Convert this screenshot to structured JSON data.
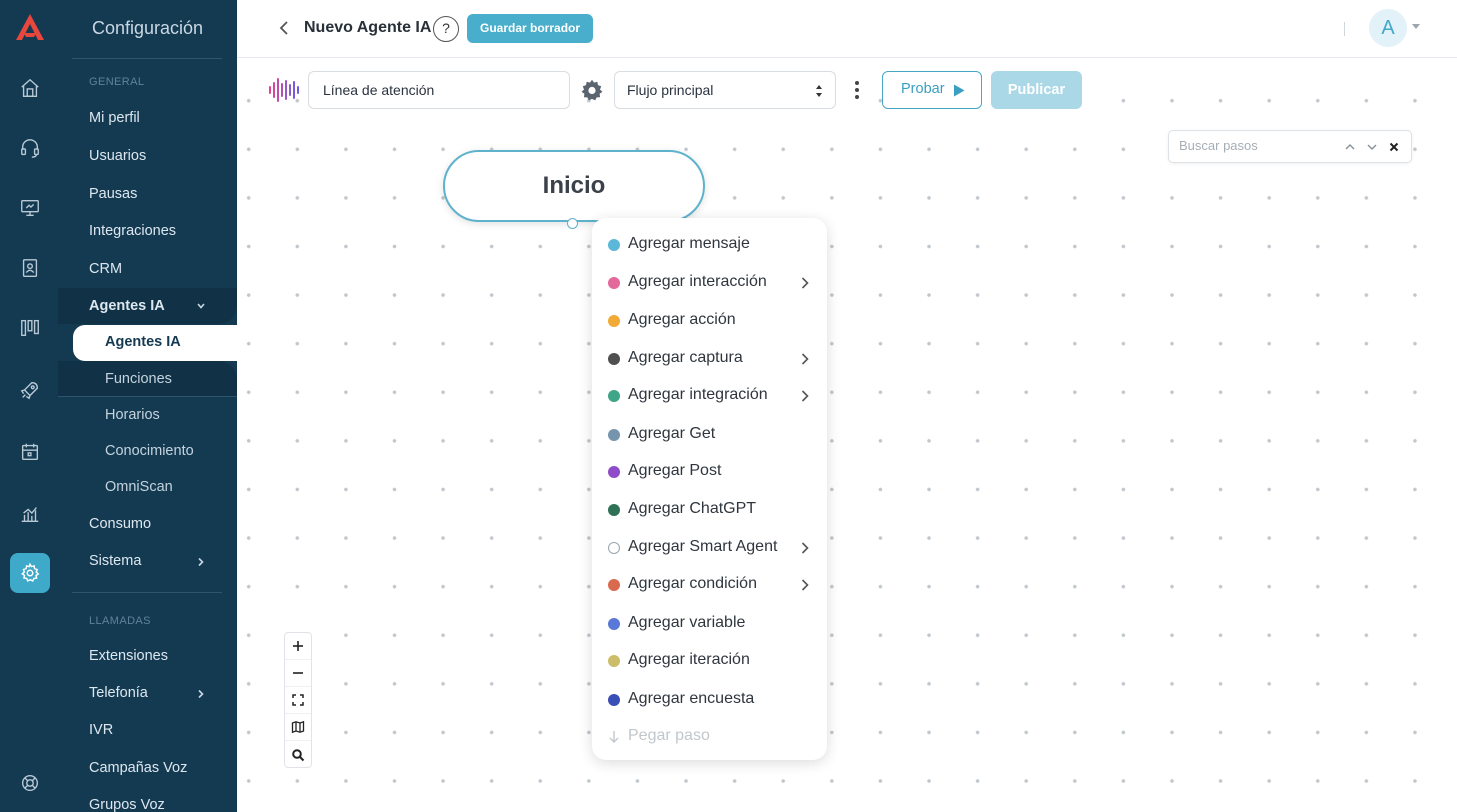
{
  "sidebar": {
    "title": "Configuración",
    "section_general": "GENERAL",
    "section_calls": "LLAMADAS",
    "items": {
      "profile": "Mi perfil",
      "users": "Usuarios",
      "pauses": "Pausas",
      "integrations": "Integraciones",
      "crm": "CRM",
      "ai_agents": "Agentes IA",
      "consumption": "Consumo",
      "system": "Sistema",
      "extensions": "Extensiones",
      "telephony": "Telefonía",
      "ivr": "IVR",
      "voice_campaigns": "Campañas Voz",
      "voice_groups": "Grupos Voz"
    },
    "ai_sub": {
      "agents": "Agentes IA",
      "functions": "Funciones",
      "schedules": "Horarios",
      "knowledge": "Conocimiento",
      "omniscan": "OmniScan"
    }
  },
  "header": {
    "title": "Nuevo Agente IA",
    "help": "?",
    "save_draft": "Guardar borrador",
    "avatar_initial": "A"
  },
  "toolbar": {
    "agent_name": "Línea de atención",
    "flow": "Flujo principal",
    "test": "Probar",
    "publish": "Publicar"
  },
  "canvas": {
    "search_placeholder": "Buscar pasos",
    "start_node": "Inicio"
  },
  "menu": {
    "items": [
      {
        "label": "Agregar mensaje",
        "color": "#5bb8d8",
        "submenu": false
      },
      {
        "label": "Agregar interacción",
        "color": "#e3689c",
        "submenu": true
      },
      {
        "label": "Agregar acción",
        "color": "#f0aa35",
        "submenu": false
      },
      {
        "label": "Agregar captura",
        "color": "#4f4f4f",
        "submenu": true
      },
      {
        "label": "Agregar integración",
        "color": "#3fa587",
        "submenu": true
      },
      {
        "label": "Agregar Get",
        "color": "#7495ad",
        "submenu": false
      },
      {
        "label": "Agregar Post",
        "color": "#8e4cc9",
        "submenu": false
      },
      {
        "label": "Agregar ChatGPT",
        "color": "#2f7157",
        "submenu": false
      },
      {
        "label": "Agregar Smart Agent",
        "color": "#ffffff",
        "submenu": true
      },
      {
        "label": "Agregar condición",
        "color": "#d9694f",
        "submenu": true
      },
      {
        "label": "Agregar variable",
        "color": "#5a78d8",
        "submenu": false
      },
      {
        "label": "Agregar iteración",
        "color": "#cbbd6a",
        "submenu": false
      },
      {
        "label": "Agregar encuesta",
        "color": "#3a4fb5",
        "submenu": false
      }
    ],
    "paste": "Pegar paso"
  },
  "colors": {
    "sidebar_bg": "#143a52",
    "accent": "#46a7c7",
    "publish_disabled": "#aad8e7"
  }
}
